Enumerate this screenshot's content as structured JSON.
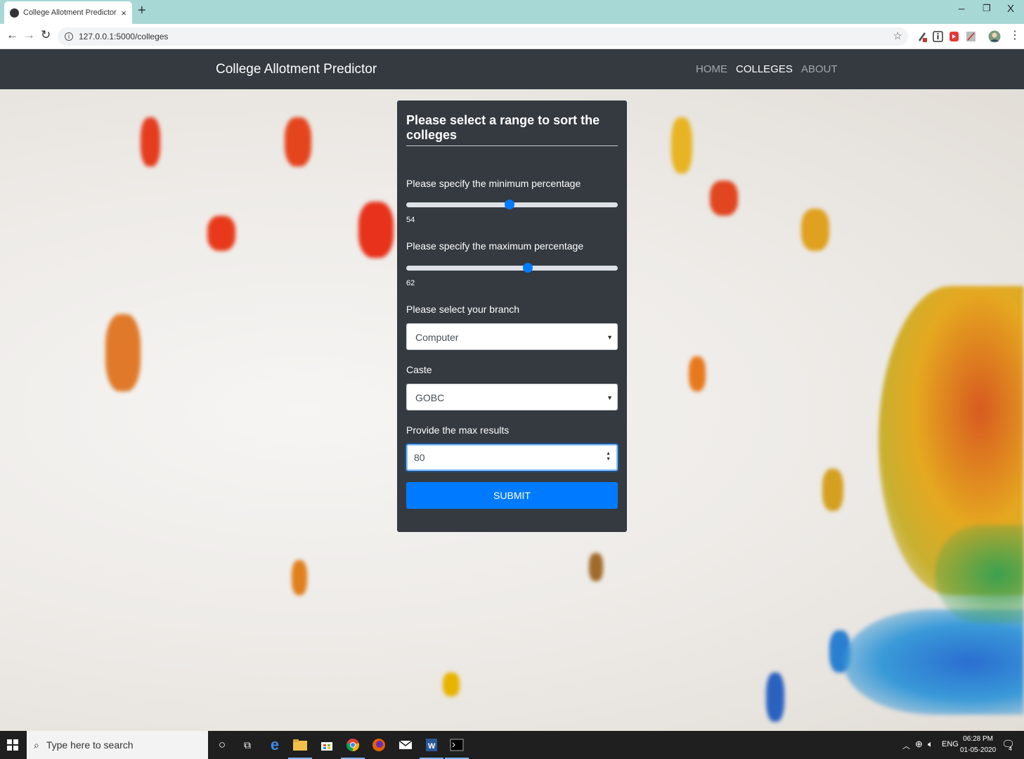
{
  "browser": {
    "tab_title": "College Allotment Predictor usin",
    "tab_close": "×",
    "new_tab": "+",
    "url": "127.0.0.1:5000/colleges",
    "window_controls": {
      "minimize": "–",
      "restore": "❐",
      "close": "X"
    }
  },
  "navbar": {
    "brand": "College Allotment Predictor",
    "links": [
      {
        "label": "HOME",
        "active": false
      },
      {
        "label": "COLLEGES",
        "active": true
      },
      {
        "label": "ABOUT",
        "active": false
      }
    ]
  },
  "form": {
    "title": "Please select a range to sort the colleges",
    "min_label": "Please specify the minimum percentage",
    "min_value": "54",
    "max_label": "Please specify the maximum percentage",
    "max_value": "62",
    "branch_label": "Please select your branch",
    "branch_value": "Computer",
    "caste_label": "Caste",
    "caste_value": "GOBC",
    "max_results_label": "Provide the max results",
    "max_results_value": "80",
    "submit_label": "SUBMIT",
    "slider_min_fraction": 0.49,
    "slider_max_fraction": 0.575
  },
  "taskbar": {
    "search_placeholder": "Type here to search",
    "language": "ENG",
    "time": "06:28 PM",
    "date": "01-05-2020",
    "notifications": "4"
  },
  "colors": {
    "navbar_bg": "#343a40",
    "primary": "#007bff",
    "tabbar_bg": "#a7d8d6"
  }
}
